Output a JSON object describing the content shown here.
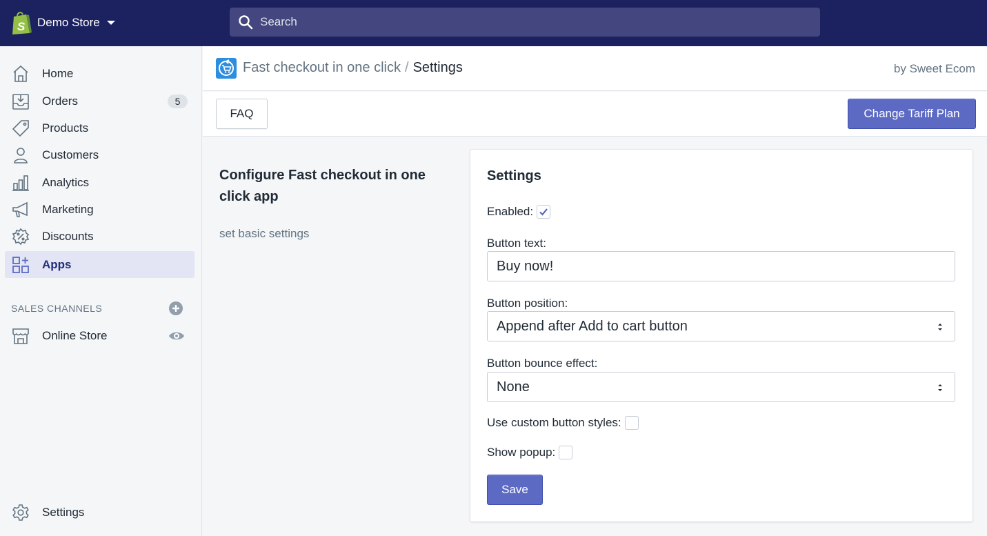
{
  "topbar": {
    "store_name": "Demo Store",
    "store_logo_icon": "shopify-bag-icon",
    "search": {
      "placeholder": "Search",
      "value": ""
    },
    "background_color": "#1c2260"
  },
  "sidebar": {
    "items": [
      {
        "label": "Home",
        "icon": "home-icon"
      },
      {
        "label": "Orders",
        "icon": "orders-icon",
        "badge": "5"
      },
      {
        "label": "Products",
        "icon": "tag-icon"
      },
      {
        "label": "Customers",
        "icon": "person-icon"
      },
      {
        "label": "Analytics",
        "icon": "bar-chart-icon"
      },
      {
        "label": "Marketing",
        "icon": "megaphone-icon"
      },
      {
        "label": "Discounts",
        "icon": "discount-icon"
      },
      {
        "label": "Apps",
        "icon": "apps-icon",
        "active": true
      }
    ],
    "sales_channels": {
      "title": "SALES CHANNELS",
      "add_icon": "plus-circle-icon",
      "items": [
        {
          "label": "Online Store",
          "icon": "store-icon",
          "action_icon": "eye-icon"
        }
      ]
    },
    "settings": {
      "label": "Settings",
      "icon": "gear-icon"
    }
  },
  "app_header": {
    "app_icon": "fast-checkout-app-icon",
    "app_name": "Fast checkout in one click",
    "separator": "/",
    "current_page": "Settings",
    "by_line": "by Sweet Ecom"
  },
  "toolbar": {
    "faq_label": "FAQ",
    "tariff_label": "Change Tariff Plan"
  },
  "annotation": {
    "title": "Configure Fast checkout in one click app",
    "description": "set basic settings"
  },
  "settings_card": {
    "title": "Settings",
    "enabled": {
      "label": "Enabled:",
      "checked": true
    },
    "button_text": {
      "label": "Button text:",
      "value": "Buy now!"
    },
    "button_position": {
      "label": "Button position:",
      "selected": "Append after Add to cart button"
    },
    "bounce_effect": {
      "label": "Button bounce effect:",
      "selected": "None"
    },
    "custom_styles": {
      "label": "Use custom button styles:",
      "checked": false
    },
    "show_popup": {
      "label": "Show popup:",
      "checked": false
    },
    "save_label": "Save"
  },
  "colors": {
    "accent": "#5c6ac4",
    "active_nav_bg": "#e3e5f4",
    "sidebar_bg": "#f4f6f8"
  }
}
